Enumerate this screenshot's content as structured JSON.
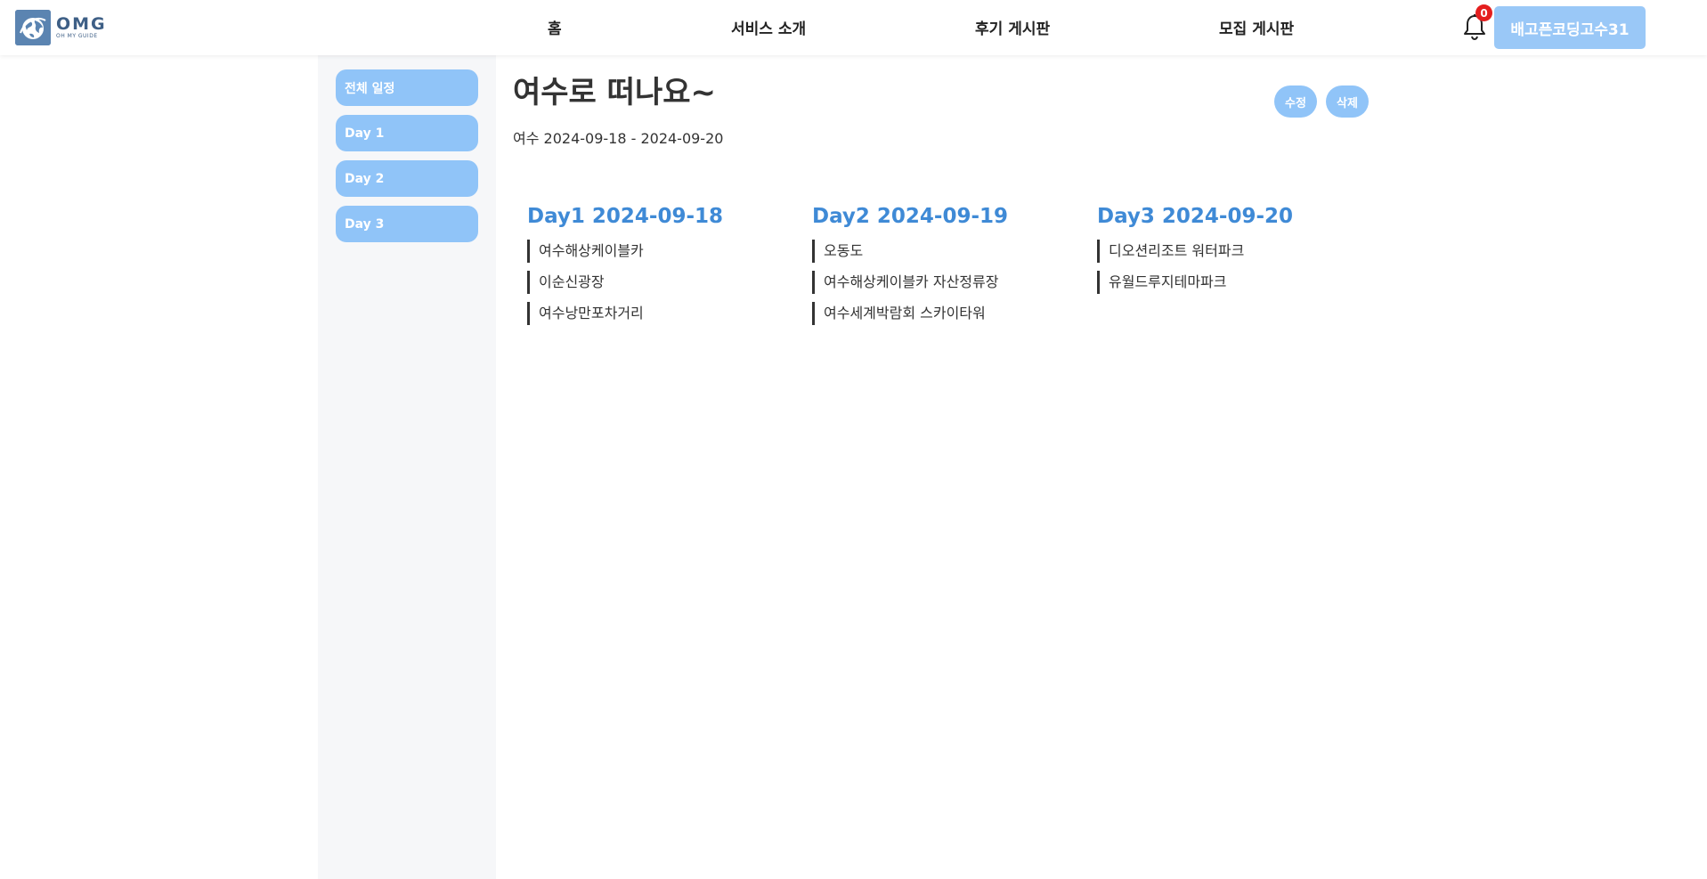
{
  "header": {
    "logo": {
      "main": "OMG",
      "sub": "OH MY GUIDE"
    },
    "nav": [
      "홈",
      "서비스 소개",
      "후기 게시판",
      "모집 게시판"
    ],
    "notification_count": "0",
    "user_button": "배고픈코딩고수31"
  },
  "sidebar": {
    "items": [
      "전체 일정",
      "Day 1",
      "Day 2",
      "Day 3"
    ]
  },
  "trip": {
    "title": "여수로 떠나요~",
    "subtitle": "여수 2024-09-18 - 2024-09-20",
    "edit_label": "수정",
    "delete_label": "삭제"
  },
  "days": [
    {
      "heading": "Day1 2024-09-18",
      "places": [
        "여수해상케이블카",
        "이순신광장",
        "여수낭만포차거리"
      ]
    },
    {
      "heading": "Day2 2024-09-19",
      "places": [
        "오동도",
        "여수해상케이블카 자산정류장",
        "여수세계박람회 스카이타워"
      ]
    },
    {
      "heading": "Day3 2024-09-20",
      "places": [
        "디오션리조트 워터파크",
        "유월드루지테마파크"
      ]
    }
  ],
  "colors": {
    "accent": "#3f8ad6",
    "button": "#90c4f8",
    "user_button": "#9ac8f7",
    "badge": "#e41e1e",
    "sidebar_bg": "#f6f7f9"
  },
  "icons": {
    "logo": "globe-logo-icon",
    "notification": "bell-icon"
  }
}
